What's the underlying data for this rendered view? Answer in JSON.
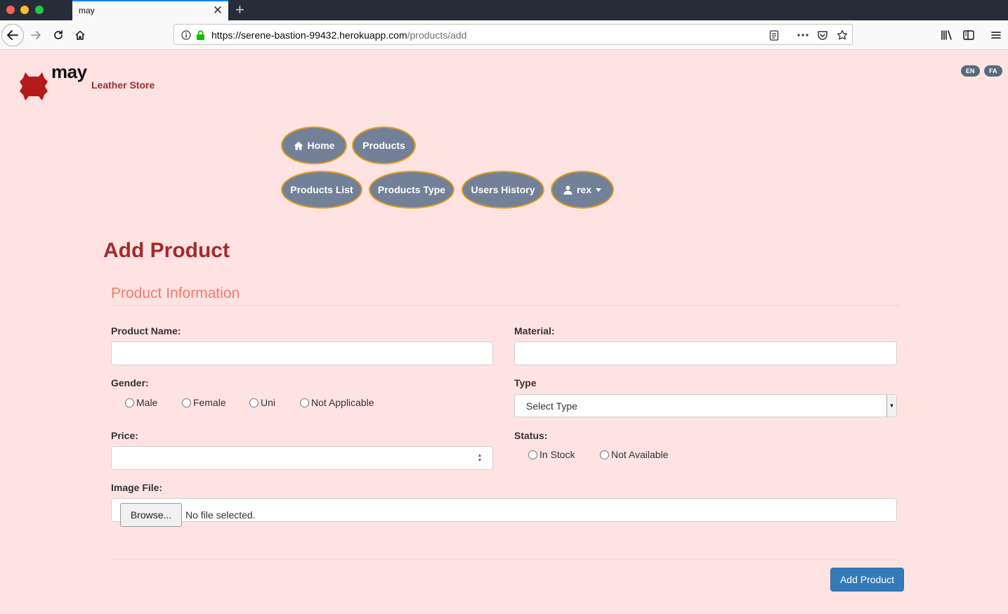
{
  "browser": {
    "tab_title": "may",
    "tab_close": "✕",
    "new_tab": "+",
    "url_host": "https://serene-bastion-99432.herokuapp.com",
    "url_path": "/products/add"
  },
  "brand": {
    "name": "may",
    "tagline": "Leather Store",
    "logo_color": "#b31b1b"
  },
  "languages": [
    "EN",
    "FA"
  ],
  "nav": {
    "home": "Home",
    "products": "Products",
    "products_list": "Products List",
    "products_type": "Products Type",
    "users_history": "Users History",
    "user": "rex"
  },
  "page": {
    "title": "Add Product",
    "section": "Product Information"
  },
  "form": {
    "product_name_label": "Product Name:",
    "product_name_value": "",
    "material_label": "Material:",
    "material_value": "",
    "gender_label": "Gender:",
    "gender_options": [
      "Male",
      "Female",
      "Uni",
      "Not Applicable"
    ],
    "type_label": "Type",
    "type_selected": "Select Type",
    "price_label": "Price:",
    "price_value": "",
    "status_label": "Status:",
    "status_options": [
      "In Stock",
      "Not Available"
    ],
    "image_label": "Image File:",
    "browse_label": "Browse...",
    "file_status": "No file selected.",
    "submit_label": "Add Product"
  },
  "colors": {
    "page_bg": "#ffe3e3",
    "accent_title": "#a52a2a",
    "section_title": "#f07d6d",
    "pill_bg": "#728197",
    "pill_border": "#e2a11d",
    "primary_button": "#337ab7"
  }
}
